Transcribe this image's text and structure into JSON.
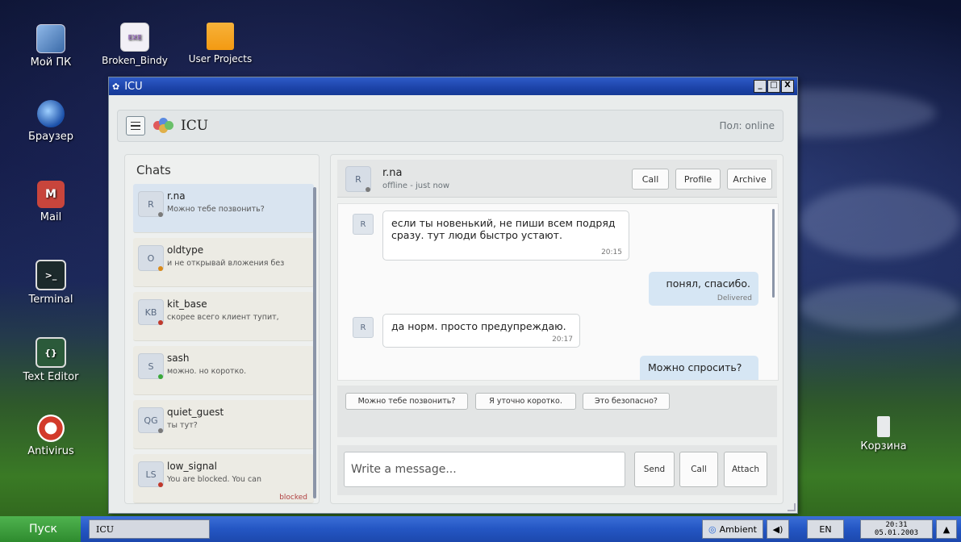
{
  "desktop": {
    "icons": [
      {
        "label": "Мой ПК"
      },
      {
        "label": "Браузер"
      },
      {
        "label": "Mail"
      },
      {
        "label": "Terminal"
      },
      {
        "label": "Text Editor"
      },
      {
        "label": "Antivirus"
      },
      {
        "label": "Broken_Bindy"
      },
      {
        "label": "User Projects"
      },
      {
        "label": "Корзина"
      }
    ],
    "mail_glyph": "M",
    "terminal_glyph": ">_",
    "editor_glyph": "{}",
    "exe_glyph": "EXE"
  },
  "window": {
    "title": "ICU",
    "buttons": [
      "_",
      "□",
      "X"
    ]
  },
  "header": {
    "title": "ICU",
    "status": "Пол: online"
  },
  "sidebar": {
    "title": "Chats",
    "chats": [
      {
        "initials": "R",
        "name": "r.na",
        "preview": "Можно тебе позвонить?",
        "status_color": "#7a7a7a",
        "active": true
      },
      {
        "initials": "O",
        "name": "oldtype",
        "preview": "и не открывай вложения без",
        "status_color": "#d98a1a"
      },
      {
        "initials": "KB",
        "name": "kit_base",
        "preview": "скорее всего клиент тупит,",
        "status_color": "#c0392b"
      },
      {
        "initials": "S",
        "name": "sash",
        "preview": "можно. но коротко.",
        "status_color": "#3aa83a"
      },
      {
        "initials": "QG",
        "name": "quiet_guest",
        "preview": "ты тут?",
        "status_color": "#7a7a7a"
      },
      {
        "initials": "LS",
        "name": "low_signal",
        "preview": "You are blocked. You can",
        "status_color": "#c0392b",
        "badge": "blocked"
      }
    ]
  },
  "chat": {
    "contact_initials": "R",
    "contact_name": "r.na",
    "contact_status": "offline - just now",
    "buttons": {
      "call": "Call",
      "profile": "Profile",
      "archive": "Archive"
    },
    "messages": [
      {
        "dir": "in",
        "initials": "R",
        "text_line1": "если ты новенький, не пиши всем подряд",
        "text_line2": "сразу. тут люди быстро устают.",
        "time": "20:15"
      },
      {
        "dir": "out",
        "text": "понял, спасибо.",
        "meta": "Delivered"
      },
      {
        "dir": "in",
        "initials": "R",
        "text": "да норм. просто предупреждаю.",
        "time": "20:17"
      },
      {
        "dir": "out",
        "text": "Можно спросить?"
      }
    ],
    "quick_replies": [
      "Можно тебе позвонить?",
      "Я уточно коротко.",
      "Это безопасно?"
    ],
    "composer": {
      "placeholder": "Write a message...",
      "send": "Send",
      "call": "Call",
      "attach": "Attach"
    }
  },
  "taskbar": {
    "start": "Пуск",
    "task": "ICU",
    "ambient": "Ambient",
    "lang": "EN",
    "time": "20:31",
    "date": "05.01.2003"
  },
  "colors": {
    "accent": "#2456c3",
    "bubble_out": "#d6e6f4",
    "active_chat": "#d9e4f0"
  }
}
